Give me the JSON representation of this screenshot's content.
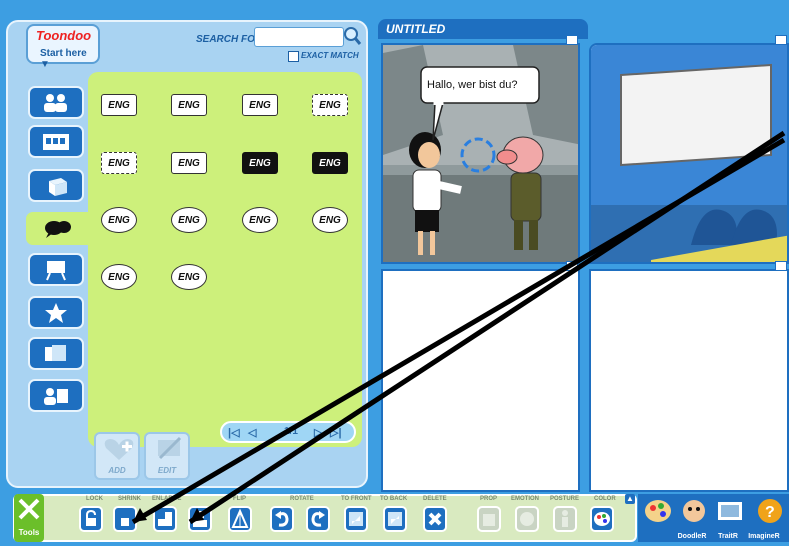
{
  "logo": {
    "brand": "Toondoo",
    "start_here": "Start here ▼"
  },
  "search": {
    "label": "SEARCH FOR",
    "value": "",
    "exact_match": "EXACT MATCH"
  },
  "categories": [
    "characters",
    "scenes",
    "props",
    "speech-bubbles",
    "text",
    "special-effects",
    "backgrounds",
    "templates"
  ],
  "bubbles": [
    {
      "text": "ENG",
      "style": "speech"
    },
    {
      "text": "ENG",
      "style": "thought-small"
    },
    {
      "text": "ENG",
      "style": "speech-square"
    },
    {
      "text": "ENG",
      "style": "dashed"
    },
    {
      "text": "ENG",
      "style": "dashed"
    },
    {
      "text": "ENG",
      "style": "plain"
    },
    {
      "text": "ENG",
      "style": "black"
    },
    {
      "text": "ENG",
      "style": "black"
    },
    {
      "text": "ENG",
      "style": "round"
    },
    {
      "text": "ENG",
      "style": "round-thought"
    },
    {
      "text": "ENG",
      "style": "cloud"
    },
    {
      "text": "ENG",
      "style": "cloud"
    },
    {
      "text": "ENG",
      "style": "spiky"
    },
    {
      "text": "ENG",
      "style": "spiky-thought"
    }
  ],
  "pager": {
    "indicator": "1/1"
  },
  "library_actions": {
    "add": "ADD",
    "edit": "EDIT"
  },
  "strip": {
    "title": "UNTITLED",
    "speech": "Hallo, wer bist du?"
  },
  "toolbar": {
    "tools_label": "Tools",
    "labels": [
      "LOCK",
      "SHRINK",
      "ENLARGE",
      "FLIP",
      "ROTATE",
      "TO FRONT",
      "TO BACK",
      "DELETE",
      "PROP",
      "EMOTION",
      "POSTURE",
      "COLOR"
    ],
    "right_tools": [
      "DoodleR",
      "TraitR",
      "ImagineR"
    ]
  },
  "colors": {
    "background": "#3d9ee2",
    "accent": "#1e6fc0",
    "library": "#cdf07b"
  }
}
